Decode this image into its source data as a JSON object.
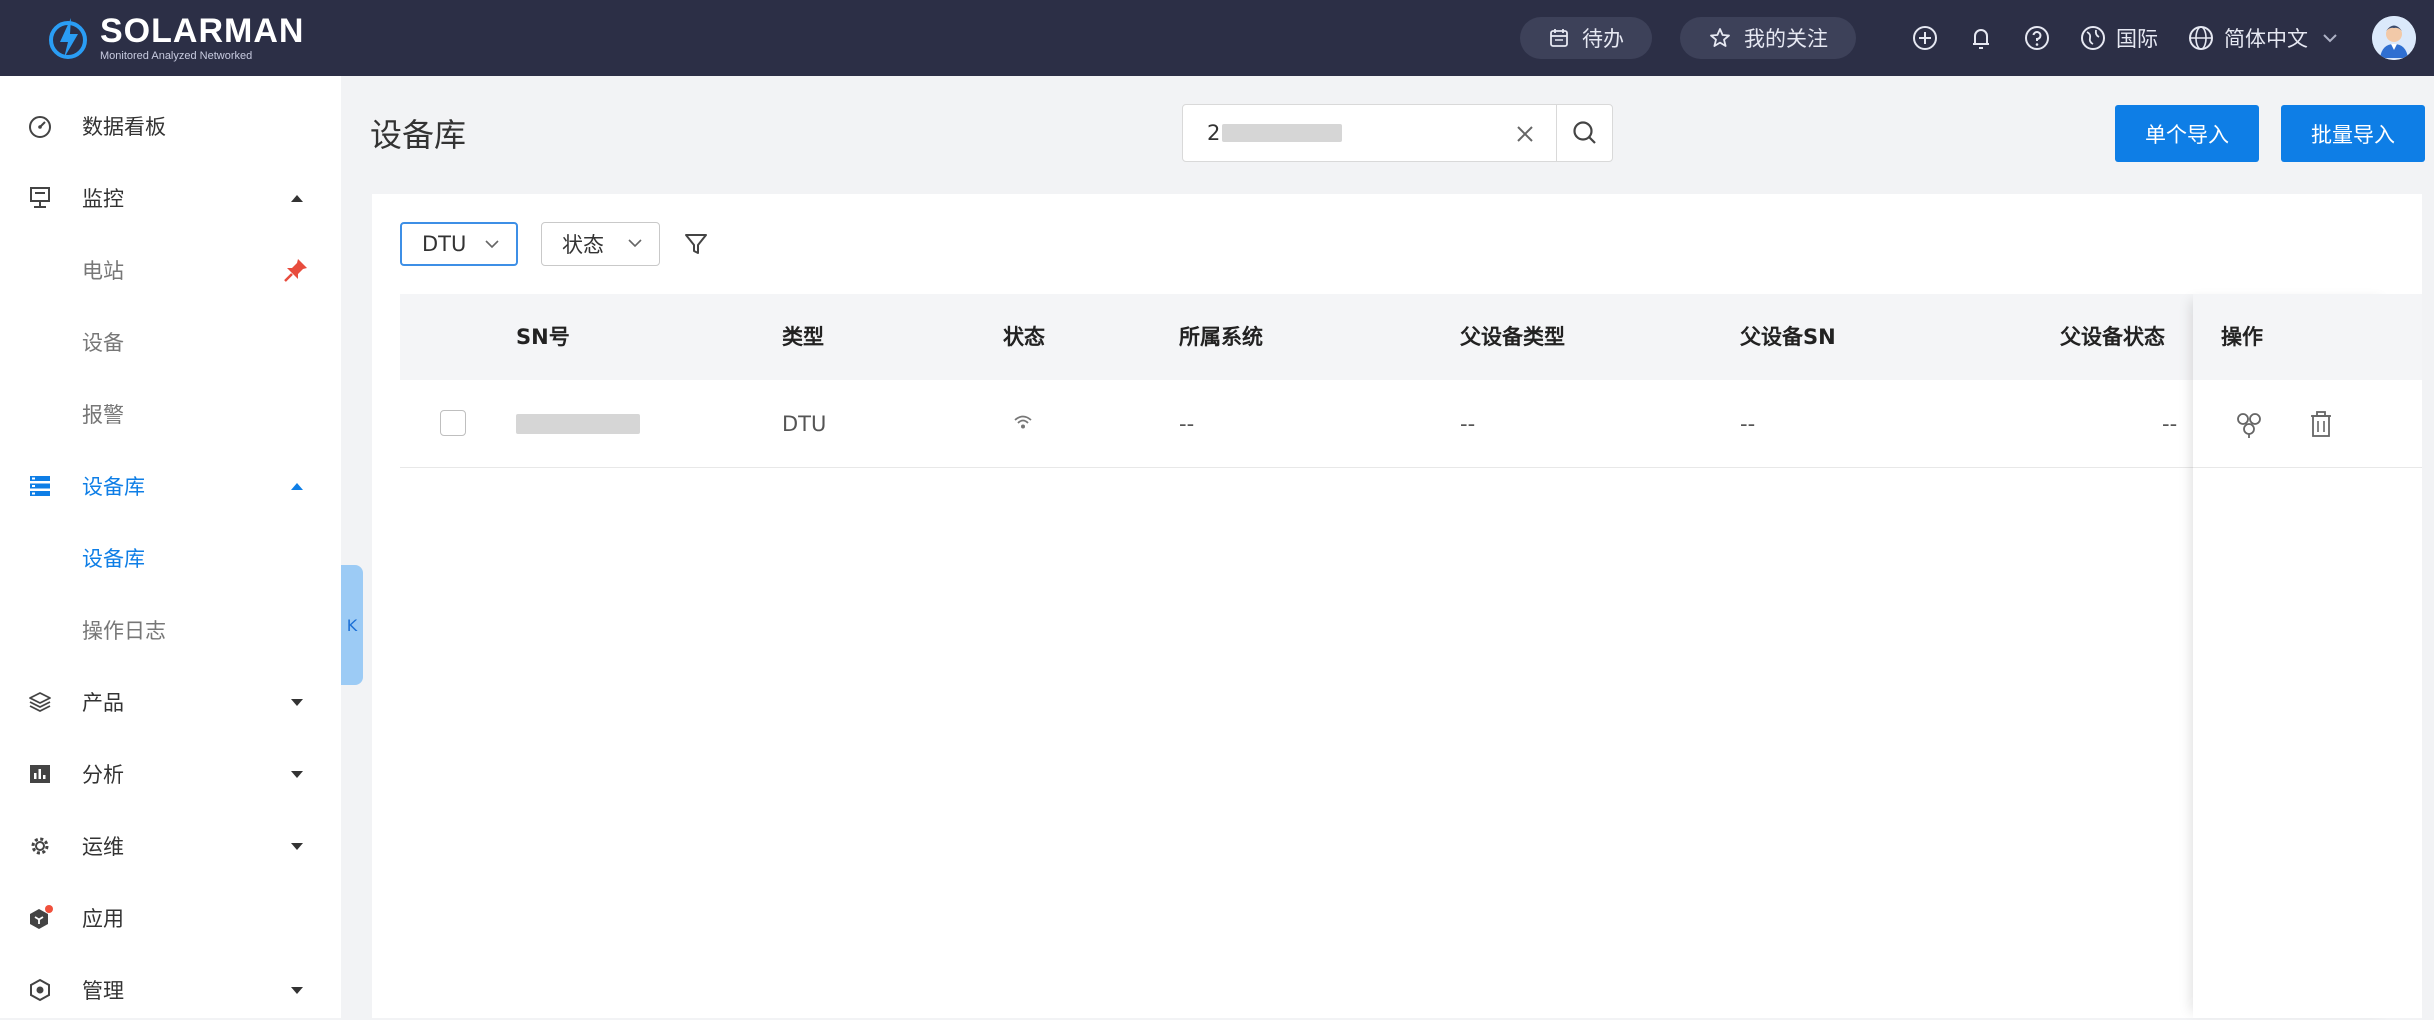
{
  "brand": {
    "name": "SOLARMAN",
    "tagline": "Monitored Analyzed Networked"
  },
  "topbar": {
    "todo_label": "待办",
    "favorites_label": "我的关注",
    "region_label": "国际",
    "language_label": "简体中文",
    "icons": [
      "add-circle-icon",
      "bell-icon",
      "help-icon",
      "globe-region-icon",
      "language-globe-icon",
      "chevron-down-icon"
    ]
  },
  "sidebar": {
    "items": [
      {
        "label": "数据看板",
        "icon": "dashboard-gauge-icon"
      },
      {
        "label": "监控",
        "icon": "monitor-icon"
      },
      {
        "label": "电站",
        "icon": "pin-icon"
      },
      {
        "label": "设备"
      },
      {
        "label": "报警"
      },
      {
        "label": "设备库",
        "icon": "device-library-icon"
      },
      {
        "label": "设备库"
      },
      {
        "label": "操作日志"
      },
      {
        "label": "产品",
        "icon": "layers-icon"
      },
      {
        "label": "分析",
        "icon": "bar-chart-icon"
      },
      {
        "label": "运维",
        "icon": "gear-icon"
      },
      {
        "label": "应用",
        "icon": "app-cube-icon"
      },
      {
        "label": "管理",
        "icon": "manage-hexagon-icon"
      }
    ],
    "collapse_glyph": "K"
  },
  "page": {
    "title": "设备库",
    "search": {
      "value_prefix": "2"
    },
    "buttons": {
      "single_import": "单个导入",
      "batch_import": "批量导入"
    }
  },
  "filters": {
    "type": "DTU",
    "status": "状态"
  },
  "table": {
    "headers": [
      "SN号",
      "类型",
      "状态",
      "所属系统",
      "父设备类型",
      "父设备SN",
      "父设备状态",
      "操作"
    ],
    "rows": [
      {
        "type": "DTU",
        "system": "--",
        "parent_type": "--",
        "parent_sn": "--",
        "parent_status": "--"
      }
    ]
  },
  "colors": {
    "topbar": "#2c2f46",
    "primary": "#0e7ee6",
    "active_nav": "#0e7ee6"
  }
}
